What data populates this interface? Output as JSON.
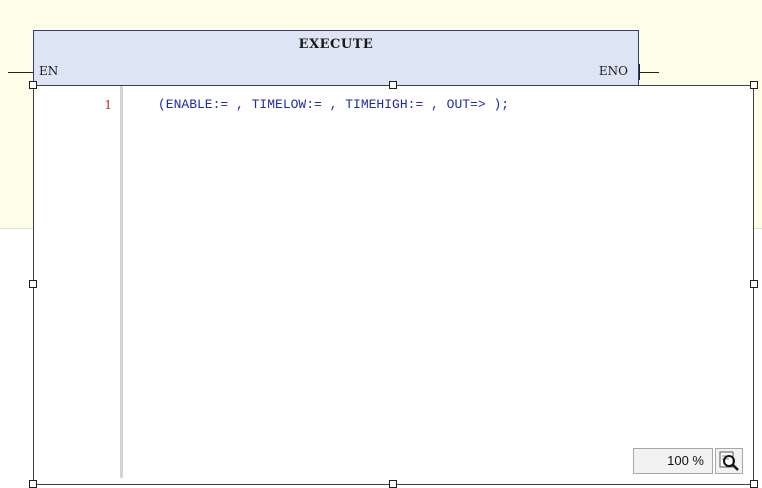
{
  "function_block": {
    "title": "EXECUTE",
    "pin_in": "EN",
    "pin_out": "ENO"
  },
  "editor": {
    "line_number": "1",
    "code": "(ENABLE:= , TIMELOW:= , TIMEHIGH:= , OUT=> );"
  },
  "zoom": {
    "level": "100 %",
    "icon": "magnifier-icon"
  },
  "colors": {
    "canvas_background": "#fdfde8",
    "block_fill": "#dde5f5",
    "code_text": "#1f2aa8",
    "line_number": "#b03030"
  }
}
